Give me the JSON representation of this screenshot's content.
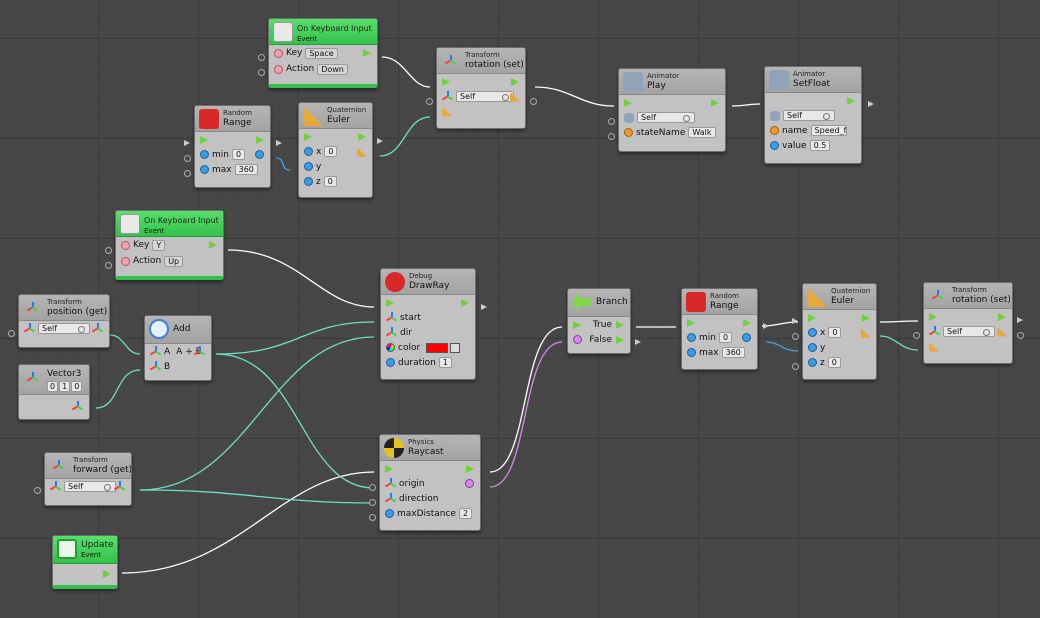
{
  "nodes": {
    "kb_space": {
      "title": "On Keyboard Input",
      "category": "Event",
      "key_label": "Key",
      "key_value": "Space",
      "action_label": "Action",
      "action_value": "Down"
    },
    "transform_rot1": {
      "category": "Transform",
      "title": "rotation (set)",
      "target": "Self"
    },
    "animator_play": {
      "category": "Animator",
      "title": "Play",
      "target": "Self",
      "state_label": "stateName",
      "state_value": "Walk"
    },
    "animator_setfloat": {
      "category": "Animator",
      "title": "SetFloat",
      "target": "Self",
      "name_label": "name",
      "name_value": "Speed_f",
      "value_label": "value",
      "value_value": "0.5"
    },
    "random1": {
      "category": "Random",
      "title": "Range",
      "min_label": "min",
      "min_value": "0",
      "max_label": "max",
      "max_value": "360"
    },
    "quat1": {
      "category": "Quaternion",
      "title": "Euler",
      "x_label": "x",
      "x_value": "0",
      "y_label": "y",
      "z_label": "z",
      "z_value": "0"
    },
    "kb_y": {
      "title": "On Keyboard Input",
      "category": "Event",
      "key_label": "Key",
      "key_value": "Y",
      "action_label": "Action",
      "action_value": "Up"
    },
    "transform_pos": {
      "category": "Transform",
      "title": "position (get)",
      "target": "Self"
    },
    "add": {
      "title": "Add",
      "a_label": "A",
      "a_out": "A + B",
      "b_label": "B"
    },
    "vector3": {
      "title": "Vector3",
      "x": "0",
      "y": "1",
      "z": "0"
    },
    "debug": {
      "category": "Debug",
      "title": "DrawRay",
      "start_label": "start",
      "dir_label": "dir",
      "color_label": "color",
      "color_value": "#ff0000",
      "duration_label": "duration",
      "duration_value": "1"
    },
    "transform_fwd": {
      "category": "Transform",
      "title": "forward (get)",
      "target": "Self"
    },
    "physics": {
      "category": "Physics",
      "title": "Raycast",
      "origin_label": "origin",
      "direction_label": "direction",
      "maxdist_label": "maxDistance",
      "maxdist_value": "2"
    },
    "update": {
      "title": "Update",
      "category": "Event"
    },
    "branch": {
      "title": "Branch",
      "true_label": "True",
      "false_label": "False"
    },
    "random2": {
      "category": "Random",
      "title": "Range",
      "min_label": "min",
      "min_value": "0",
      "max_label": "max",
      "max_value": "360"
    },
    "quat2": {
      "category": "Quaternion",
      "title": "Euler",
      "x_label": "x",
      "x_value": "0",
      "y_label": "y",
      "z_label": "z",
      "z_value": "0"
    },
    "transform_rot2": {
      "category": "Transform",
      "title": "rotation (set)",
      "target": "Self"
    }
  },
  "colors": {
    "flow_port": "#6fd13a",
    "value_port": "#3a9de4",
    "event_header": "#3fcf55",
    "value_wire": "#6fe0c0",
    "bool_wire": "#d788e8",
    "flow_wire": "#ffffff",
    "grid": "#474747"
  },
  "icons": {
    "keyboard": "keyboard-icon",
    "transform": "transform-axis-icon",
    "animator": "animator-icon",
    "random": "dice-icon",
    "quaternion": "angle-icon",
    "add": "plus-circle-icon",
    "vector": "vector-axis-icon",
    "debug": "ladybug-icon",
    "physics": "physics-ball-icon",
    "update": "update-loop-icon",
    "branch": "branch-icon"
  }
}
